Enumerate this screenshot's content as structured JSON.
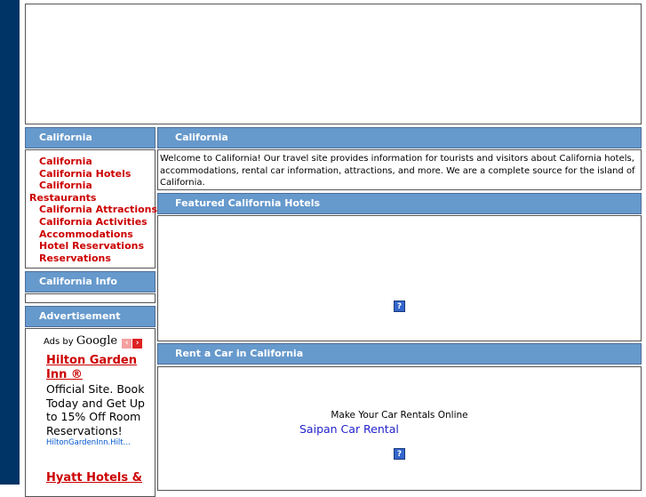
{
  "left_column": {
    "nav_header": "California",
    "nav_links": [
      "California",
      "California Hotels",
      "California Restaurants",
      "California Attractions",
      "California Activities",
      "Accommodations",
      "Hotel Reservations",
      "Reservations"
    ],
    "info_header": "California Info",
    "ad_header": "Advertisement",
    "ads_by": "Ads by",
    "google": "Google",
    "ads": [
      {
        "title": "Hilton Garden Inn ®",
        "text": "Official Site. Book Today and Get Up to 15% Off Room Reservations!",
        "url": "HiltonGardenInn.Hilt..."
      },
      {
        "title": "Hyatt Hotels &",
        "text": "",
        "url": ""
      }
    ]
  },
  "main": {
    "header": "California",
    "welcome": "Welcome to California!  Our travel site provides information for tourists and visitors about California hotels, accommodations, rental car information, attractions, and more.  We are a complete source for the island of California.",
    "hotels_header": "Featured California Hotels",
    "car_header": "Rent a Car in California",
    "car_text": "Make Your Car Rentals Online",
    "car_link": "Saipan Car Rental",
    "placeholder_icon": "?"
  },
  "colors": {
    "header_bg": "#6699cc",
    "sidebar": "#003366",
    "link": "#cc0000"
  }
}
